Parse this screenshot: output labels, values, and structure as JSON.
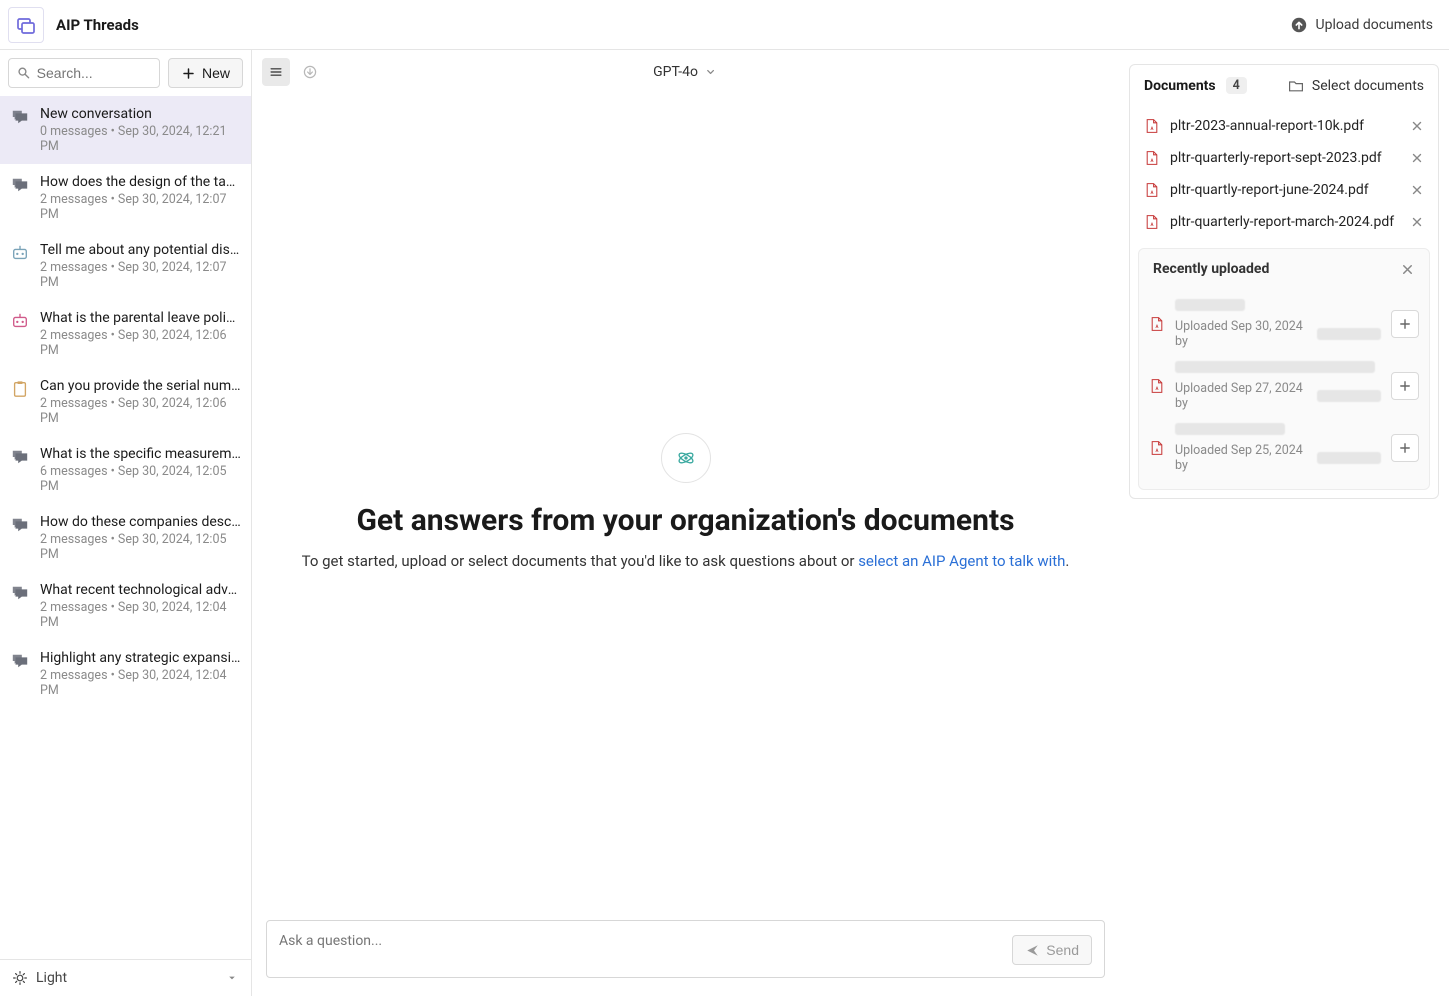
{
  "app": {
    "title": "AIP Threads",
    "upload_label": "Upload documents"
  },
  "sidebar": {
    "search_placeholder": "Search...",
    "new_label": "New",
    "theme_label": "Light",
    "threads": [
      {
        "title": "New conversation",
        "meta": "0 messages • Sep 30, 2024, 12:21 PM",
        "icon": "chat",
        "selected": true
      },
      {
        "title": "How does the design of the taper …",
        "meta": "2 messages • Sep 30, 2024, 12:07 PM",
        "icon": "chat"
      },
      {
        "title": "Tell me about any potential disr…",
        "meta": "2 messages • Sep 30, 2024, 12:07 PM",
        "icon": "robot"
      },
      {
        "title": "What is the parental leave policy?",
        "meta": "2 messages • Sep 30, 2024, 12:06 PM",
        "icon": "robot-pink"
      },
      {
        "title": "Can you provide the serial numb…",
        "meta": "2 messages • Sep 30, 2024, 12:06 PM",
        "icon": "clipboard"
      },
      {
        "title": "What is the specific measuremen…",
        "meta": "6 messages • Sep 30, 2024, 12:05 PM",
        "icon": "chat"
      },
      {
        "title": "How do these companies describ…",
        "meta": "2 messages • Sep 30, 2024, 12:05 PM",
        "icon": "chat"
      },
      {
        "title": "What recent technological advan…",
        "meta": "2 messages • Sep 30, 2024, 12:04 PM",
        "icon": "chat"
      },
      {
        "title": "Highlight any strategic expansion…",
        "meta": "2 messages • Sep 30, 2024, 12:04 PM",
        "icon": "chat"
      }
    ]
  },
  "center": {
    "model": "GPT-4o",
    "hero_title": "Get answers from your organization's documents",
    "hero_prefix": "To get started, upload or select documents that you'd like to ask questions about or ",
    "hero_link": "select an AIP Agent to talk with",
    "hero_suffix": ".",
    "composer_placeholder": "Ask a question...",
    "send_label": "Send"
  },
  "docs": {
    "header": "Documents",
    "count": "4",
    "select_label": "Select documents",
    "files": [
      "pltr-2023-annual-report-10k.pdf",
      "pltr-quarterly-report-sept-2023.pdf",
      "pltr-quartly-report-june-2024.pdf",
      "pltr-quarterly-report-march-2024.pdf"
    ],
    "recent_header": "Recently uploaded",
    "recent": [
      {
        "date": "Uploaded Sep 30, 2024 by",
        "title_w": "w70",
        "by_w": "w66"
      },
      {
        "date": "Uploaded Sep 27, 2024 by",
        "title_w": "w200",
        "by_w": "w66"
      },
      {
        "date": "Uploaded Sep 25, 2024 by",
        "title_w": "w110",
        "by_w": "w66"
      }
    ]
  }
}
